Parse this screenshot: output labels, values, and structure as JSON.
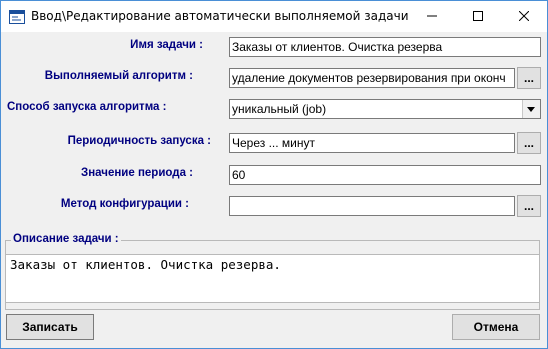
{
  "window": {
    "title": "Ввод\\Редактирование автоматически выполняемой задачи систем..."
  },
  "form": {
    "task_name": {
      "label": "Имя задачи :",
      "value": "Заказы от клиентов. Очистка резерва"
    },
    "algorithm": {
      "label": "Выполняемый алгоритм :",
      "value": "удаление документов резервирования при оконч",
      "button": "..."
    },
    "launch_method": {
      "label": "Способ запуска алгоритма :",
      "value": "уникальный (job)"
    },
    "frequency": {
      "label": "Периодичность запуска :",
      "value": "Через ... минут",
      "button": "..."
    },
    "period_value": {
      "label": "Значение периода :",
      "value": "60"
    },
    "config_method": {
      "label": "Метод конфигурации :",
      "value": "",
      "button": "..."
    }
  },
  "description": {
    "label": "Описание задачи :",
    "text": "Заказы от клиентов. Очистка резерва."
  },
  "buttons": {
    "save": "Записать",
    "cancel": "Отмена"
  },
  "icons": {
    "app": "app-window-icon",
    "minimize": "minimize-icon",
    "maximize": "maximize-icon",
    "close": "close-icon",
    "dropdown": "chevron-down-icon"
  }
}
